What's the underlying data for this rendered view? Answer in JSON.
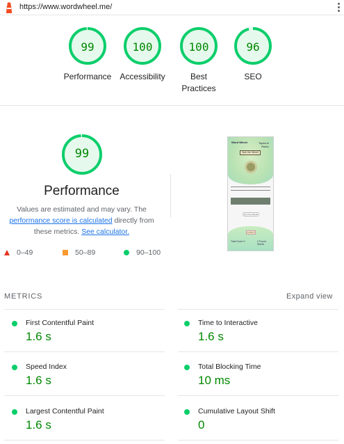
{
  "topbar": {
    "url": "https://www.wordwheel.me/"
  },
  "categories": [
    {
      "score": "99",
      "label": "Performance",
      "fraction": 0.99
    },
    {
      "score": "100",
      "label": "Accessibility",
      "fraction": 1.0
    },
    {
      "score": "100",
      "label": "Best Practices",
      "fraction": 1.0
    },
    {
      "score": "96",
      "label": "SEO",
      "fraction": 0.96
    }
  ],
  "performance": {
    "score": "99",
    "fraction": 0.99,
    "title": "Performance",
    "desc_pre": "Values are estimated and may vary. The ",
    "desc_link": "performance score is calculated",
    "desc_mid": " directly from these metrics. ",
    "desc_calc": "See calculator."
  },
  "legend": {
    "fail": "0–49",
    "average": "50–89",
    "pass": "90–100"
  },
  "thumbnail": {
    "logo": "Word Wheel",
    "menu": "Topics ▾",
    "sub": "Rules",
    "spin": "Spin the Wheel",
    "button": "spin the wheel!",
    "small": "SUBMIT",
    "left": "Total Score",
    "left_num": "0",
    "right_num": "0",
    "right": "Found Words"
  },
  "metrics": {
    "heading": "METRICS",
    "expand": "Expand view",
    "items": [
      {
        "title": "First Contentful Paint",
        "value": "1.6 s"
      },
      {
        "title": "Time to Interactive",
        "value": "1.6 s"
      },
      {
        "title": "Speed Index",
        "value": "1.6 s"
      },
      {
        "title": "Total Blocking Time",
        "value": "10 ms"
      },
      {
        "title": "Largest Contentful Paint",
        "value": "1.6 s"
      },
      {
        "title": "Cumulative Layout Shift",
        "value": "0"
      }
    ]
  },
  "colors": {
    "pass": "#0cce6b",
    "pass_text": "#008800",
    "average": "#fa9a31",
    "fail": "#e8331e",
    "link": "#1a73e8"
  }
}
